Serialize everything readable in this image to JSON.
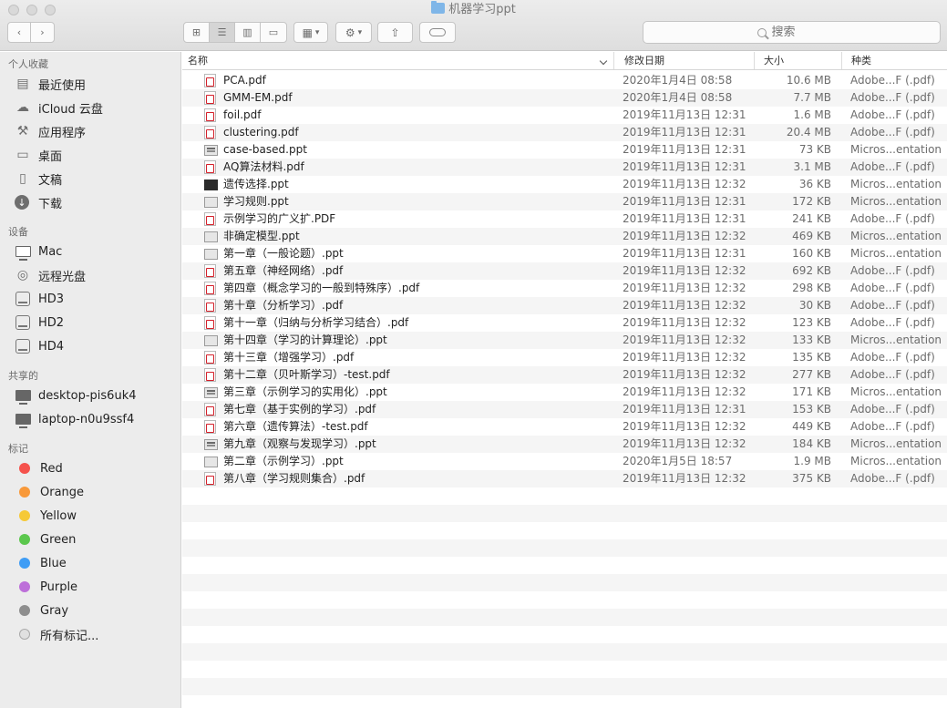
{
  "window": {
    "title": "机器学习ppt"
  },
  "toolbar": {
    "search_placeholder": "搜索"
  },
  "sidebar": {
    "favorites_header": "个人收藏",
    "favorites": [
      {
        "label": "最近使用",
        "icon": "recents-icon"
      },
      {
        "label": "iCloud 云盘",
        "icon": "cloud-icon"
      },
      {
        "label": "应用程序",
        "icon": "applications-icon"
      },
      {
        "label": "桌面",
        "icon": "desktop-icon"
      },
      {
        "label": "文稿",
        "icon": "documents-icon"
      },
      {
        "label": "下载",
        "icon": "downloads-icon"
      }
    ],
    "devices_header": "设备",
    "devices": [
      {
        "label": "Mac",
        "icon": "laptop-icon"
      },
      {
        "label": "远程光盘",
        "icon": "disc-icon"
      },
      {
        "label": "HD3",
        "icon": "disk-icon"
      },
      {
        "label": "HD2",
        "icon": "disk-icon"
      },
      {
        "label": "HD4",
        "icon": "disk-icon"
      }
    ],
    "shared_header": "共享的",
    "shared": [
      {
        "label": "desktop-pis6uk4",
        "icon": "monitor-icon"
      },
      {
        "label": "laptop-n0u9ssf4",
        "icon": "monitor-icon"
      }
    ],
    "tags_header": "标记",
    "tags": [
      {
        "label": "Red",
        "color": "#f5524c"
      },
      {
        "label": "Orange",
        "color": "#f8993a"
      },
      {
        "label": "Yellow",
        "color": "#f6c937"
      },
      {
        "label": "Green",
        "color": "#5bc74d"
      },
      {
        "label": "Blue",
        "color": "#3f9df5"
      },
      {
        "label": "Purple",
        "color": "#bd6fd9"
      },
      {
        "label": "Gray",
        "color": "#8e8e8e"
      },
      {
        "label": "所有标记...",
        "color": "#e0e0e0"
      }
    ]
  },
  "columns": {
    "name": "名称",
    "date": "修改日期",
    "size": "大小",
    "kind": "种类"
  },
  "files": [
    {
      "name": "PCA.pdf",
      "date": "2020年1月4日 08:58",
      "size": "10.6 MB",
      "kind": "Adobe...F (.pdf)",
      "type": "pdf"
    },
    {
      "name": "GMM-EM.pdf",
      "date": "2020年1月4日 08:58",
      "size": "7.7 MB",
      "kind": "Adobe...F (.pdf)",
      "type": "pdf"
    },
    {
      "name": "foil.pdf",
      "date": "2019年11月13日 12:31",
      "size": "1.6 MB",
      "kind": "Adobe...F (.pdf)",
      "type": "pdf"
    },
    {
      "name": "clustering.pdf",
      "date": "2019年11月13日 12:31",
      "size": "20.4 MB",
      "kind": "Adobe...F (.pdf)",
      "type": "pdf"
    },
    {
      "name": "case-based.ppt",
      "date": "2019年11月13日 12:31",
      "size": "73 KB",
      "kind": "Micros...entation",
      "type": "ppt-thumb"
    },
    {
      "name": "AQ算法材料.pdf",
      "date": "2019年11月13日 12:31",
      "size": "3.1 MB",
      "kind": "Adobe...F (.pdf)",
      "type": "pdf"
    },
    {
      "name": "遗传选择.ppt",
      "date": "2019年11月13日 12:32",
      "size": "36 KB",
      "kind": "Micros...entation",
      "type": "ppt-dark"
    },
    {
      "name": "学习规则.ppt",
      "date": "2019年11月13日 12:31",
      "size": "172 KB",
      "kind": "Micros...entation",
      "type": "ppt"
    },
    {
      "name": "示例学习的广义扩.PDF",
      "date": "2019年11月13日 12:31",
      "size": "241 KB",
      "kind": "Adobe...F (.pdf)",
      "type": "pdf"
    },
    {
      "name": "非确定模型.ppt",
      "date": "2019年11月13日 12:32",
      "size": "469 KB",
      "kind": "Micros...entation",
      "type": "ppt"
    },
    {
      "name": "第一章（一般论题）.ppt",
      "date": "2019年11月13日 12:31",
      "size": "160 KB",
      "kind": "Micros...entation",
      "type": "ppt"
    },
    {
      "name": "第五章（神经网络）.pdf",
      "date": "2019年11月13日 12:32",
      "size": "692 KB",
      "kind": "Adobe...F (.pdf)",
      "type": "pdf"
    },
    {
      "name": "第四章（概念学习的一般到特殊序）.pdf",
      "date": "2019年11月13日 12:32",
      "size": "298 KB",
      "kind": "Adobe...F (.pdf)",
      "type": "pdf"
    },
    {
      "name": "第十章（分析学习）.pdf",
      "date": "2019年11月13日 12:32",
      "size": "30 KB",
      "kind": "Adobe...F (.pdf)",
      "type": "pdf"
    },
    {
      "name": "第十一章（归纳与分析学习结合）.pdf",
      "date": "2019年11月13日 12:32",
      "size": "123 KB",
      "kind": "Adobe...F (.pdf)",
      "type": "pdf"
    },
    {
      "name": "第十四章（学习的计算理论）.ppt",
      "date": "2019年11月13日 12:32",
      "size": "133 KB",
      "kind": "Micros...entation",
      "type": "ppt"
    },
    {
      "name": "第十三章（增强学习）.pdf",
      "date": "2019年11月13日 12:32",
      "size": "135 KB",
      "kind": "Adobe...F (.pdf)",
      "type": "pdf"
    },
    {
      "name": "第十二章（贝叶斯学习）-test.pdf",
      "date": "2019年11月13日 12:32",
      "size": "277 KB",
      "kind": "Adobe...F (.pdf)",
      "type": "pdf"
    },
    {
      "name": "第三章（示例学习的实用化）.ppt",
      "date": "2019年11月13日 12:32",
      "size": "171 KB",
      "kind": "Micros...entation",
      "type": "ppt-thumb"
    },
    {
      "name": "第七章（基于实例的学习）.pdf",
      "date": "2019年11月13日 12:31",
      "size": "153 KB",
      "kind": "Adobe...F (.pdf)",
      "type": "pdf"
    },
    {
      "name": "第六章（遗传算法）-test.pdf",
      "date": "2019年11月13日 12:32",
      "size": "449 KB",
      "kind": "Adobe...F (.pdf)",
      "type": "pdf"
    },
    {
      "name": "第九章（观察与发现学习）.ppt",
      "date": "2019年11月13日 12:32",
      "size": "184 KB",
      "kind": "Micros...entation",
      "type": "ppt-thumb"
    },
    {
      "name": "第二章（示例学习）.ppt",
      "date": "2020年1月5日 18:57",
      "size": "1.9 MB",
      "kind": "Micros...entation",
      "type": "ppt"
    },
    {
      "name": "第八章（学习规则集合）.pdf",
      "date": "2019年11月13日 12:32",
      "size": "375 KB",
      "kind": "Adobe...F (.pdf)",
      "type": "pdf"
    }
  ]
}
